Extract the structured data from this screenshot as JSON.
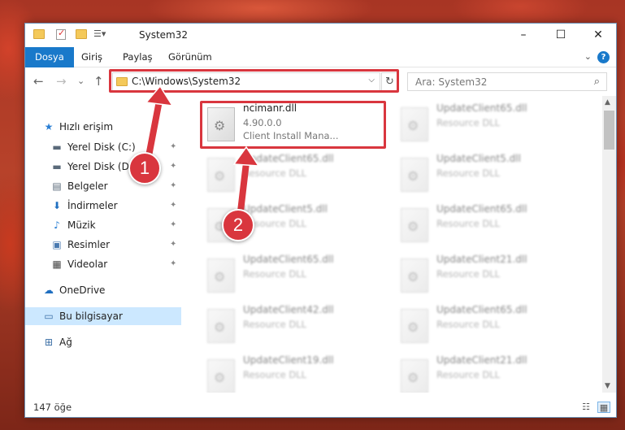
{
  "window": {
    "title": "System32",
    "controls": {
      "minimize": "–",
      "maximize": "☐",
      "close": "✕"
    }
  },
  "ribbon": {
    "tabs": [
      {
        "label": "Dosya"
      },
      {
        "label": "Giriş"
      },
      {
        "label": "Paylaş"
      },
      {
        "label": "Görünüm"
      }
    ],
    "help": "?"
  },
  "nav": {
    "back": "←",
    "forward": "→",
    "recent": "⌄",
    "up": "↑",
    "address": "C:\\Windows\\System32",
    "address_drop": "⌵",
    "refresh": "↻",
    "search_placeholder": "Ara: System32",
    "search_icon": "⌕"
  },
  "sidebar": {
    "items": [
      {
        "label": "Hızlı erişim",
        "icon": "star-icon",
        "glyph": "★",
        "color": "#2a7fd4"
      },
      {
        "label": "Yerel Disk (C:)",
        "icon": "drive-icon",
        "glyph": "▬",
        "color": "#5a6a7a",
        "pinned": true
      },
      {
        "label": "Yerel Disk (D:)",
        "icon": "drive-icon",
        "glyph": "▬",
        "color": "#5a6a7a",
        "pinned": true
      },
      {
        "label": "Belgeler",
        "icon": "documents-icon",
        "glyph": "▤",
        "color": "#5a6a7a",
        "pinned": true
      },
      {
        "label": "İndirmeler",
        "icon": "download-icon",
        "glyph": "⬇",
        "color": "#1f6fc0",
        "pinned": true
      },
      {
        "label": "Müzik",
        "icon": "music-icon",
        "glyph": "♪",
        "color": "#2a7fd4",
        "pinned": true
      },
      {
        "label": "Resimler",
        "icon": "pictures-icon",
        "glyph": "▣",
        "color": "#4a7ab0",
        "pinned": true
      },
      {
        "label": "Videolar",
        "icon": "videos-icon",
        "glyph": "▦",
        "color": "#444",
        "pinned": true
      },
      {
        "label": "OneDrive",
        "icon": "cloud-icon",
        "glyph": "☁",
        "color": "#1f6fc0"
      },
      {
        "label": "Bu bilgisayar",
        "icon": "computer-icon",
        "glyph": "▭",
        "color": "#3a6ea5",
        "selected": true
      },
      {
        "label": "Ağ",
        "icon": "network-icon",
        "glyph": "⊞",
        "color": "#3a6ea5"
      }
    ],
    "pin_glyph": "📌"
  },
  "files": [
    {
      "name": "ncimanr.dll",
      "line2": "4.90.0.0",
      "line3": "Client Install Mana...",
      "blur": false
    },
    {
      "name": "UpdateClient65.dll",
      "line2": "Resource DLL",
      "blur": true
    },
    {
      "name": "UpdateClient65.dll",
      "line2": "Resource DLL",
      "blur": true
    },
    {
      "name": "UpdateClient5.dll",
      "line2": "Resource DLL",
      "blur": true
    },
    {
      "name": "UpdateClient5.dll",
      "line2": "Resource DLL",
      "blur": true
    },
    {
      "name": "UpdateClient65.dll",
      "line2": "Resource DLL",
      "blur": true
    },
    {
      "name": "UpdateClient65.dll",
      "line2": "Resource DLL",
      "blur": true
    },
    {
      "name": "UpdateClient21.dll",
      "line2": "Resource DLL",
      "blur": true
    },
    {
      "name": "UpdateClient42.dll",
      "line2": "Resource DLL",
      "blur": true
    },
    {
      "name": "UpdateClient65.dll",
      "line2": "Resource DLL",
      "blur": true
    },
    {
      "name": "UpdateClient19.dll",
      "line2": "Resource DLL",
      "blur": true
    },
    {
      "name": "UpdateClient21.dll",
      "line2": "Resource DLL",
      "blur": true
    }
  ],
  "status": {
    "count": "147 öğe"
  },
  "callouts": [
    "1",
    "2"
  ],
  "colors": {
    "accent": "#1979ca",
    "highlight": "#d9363e",
    "selected": "#cce8ff"
  }
}
